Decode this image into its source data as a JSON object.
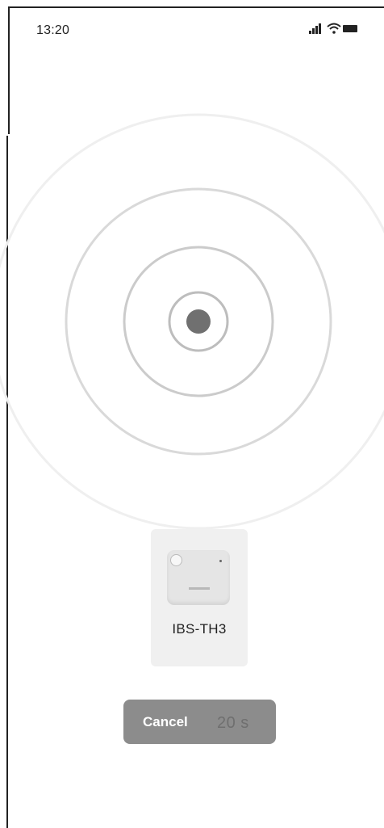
{
  "status_bar": {
    "time": "13:20",
    "icons": [
      "signal-icon",
      "wifi-icon",
      "battery-icon"
    ]
  },
  "scan": {
    "radar_color": "#c8c8c8",
    "center_dot_color": "#707070"
  },
  "device": {
    "name": "IBS-TH3",
    "image": "thermometer-sensor-image"
  },
  "actions": {
    "cancel_label": "Cancel",
    "countdown_text": "20 s"
  }
}
